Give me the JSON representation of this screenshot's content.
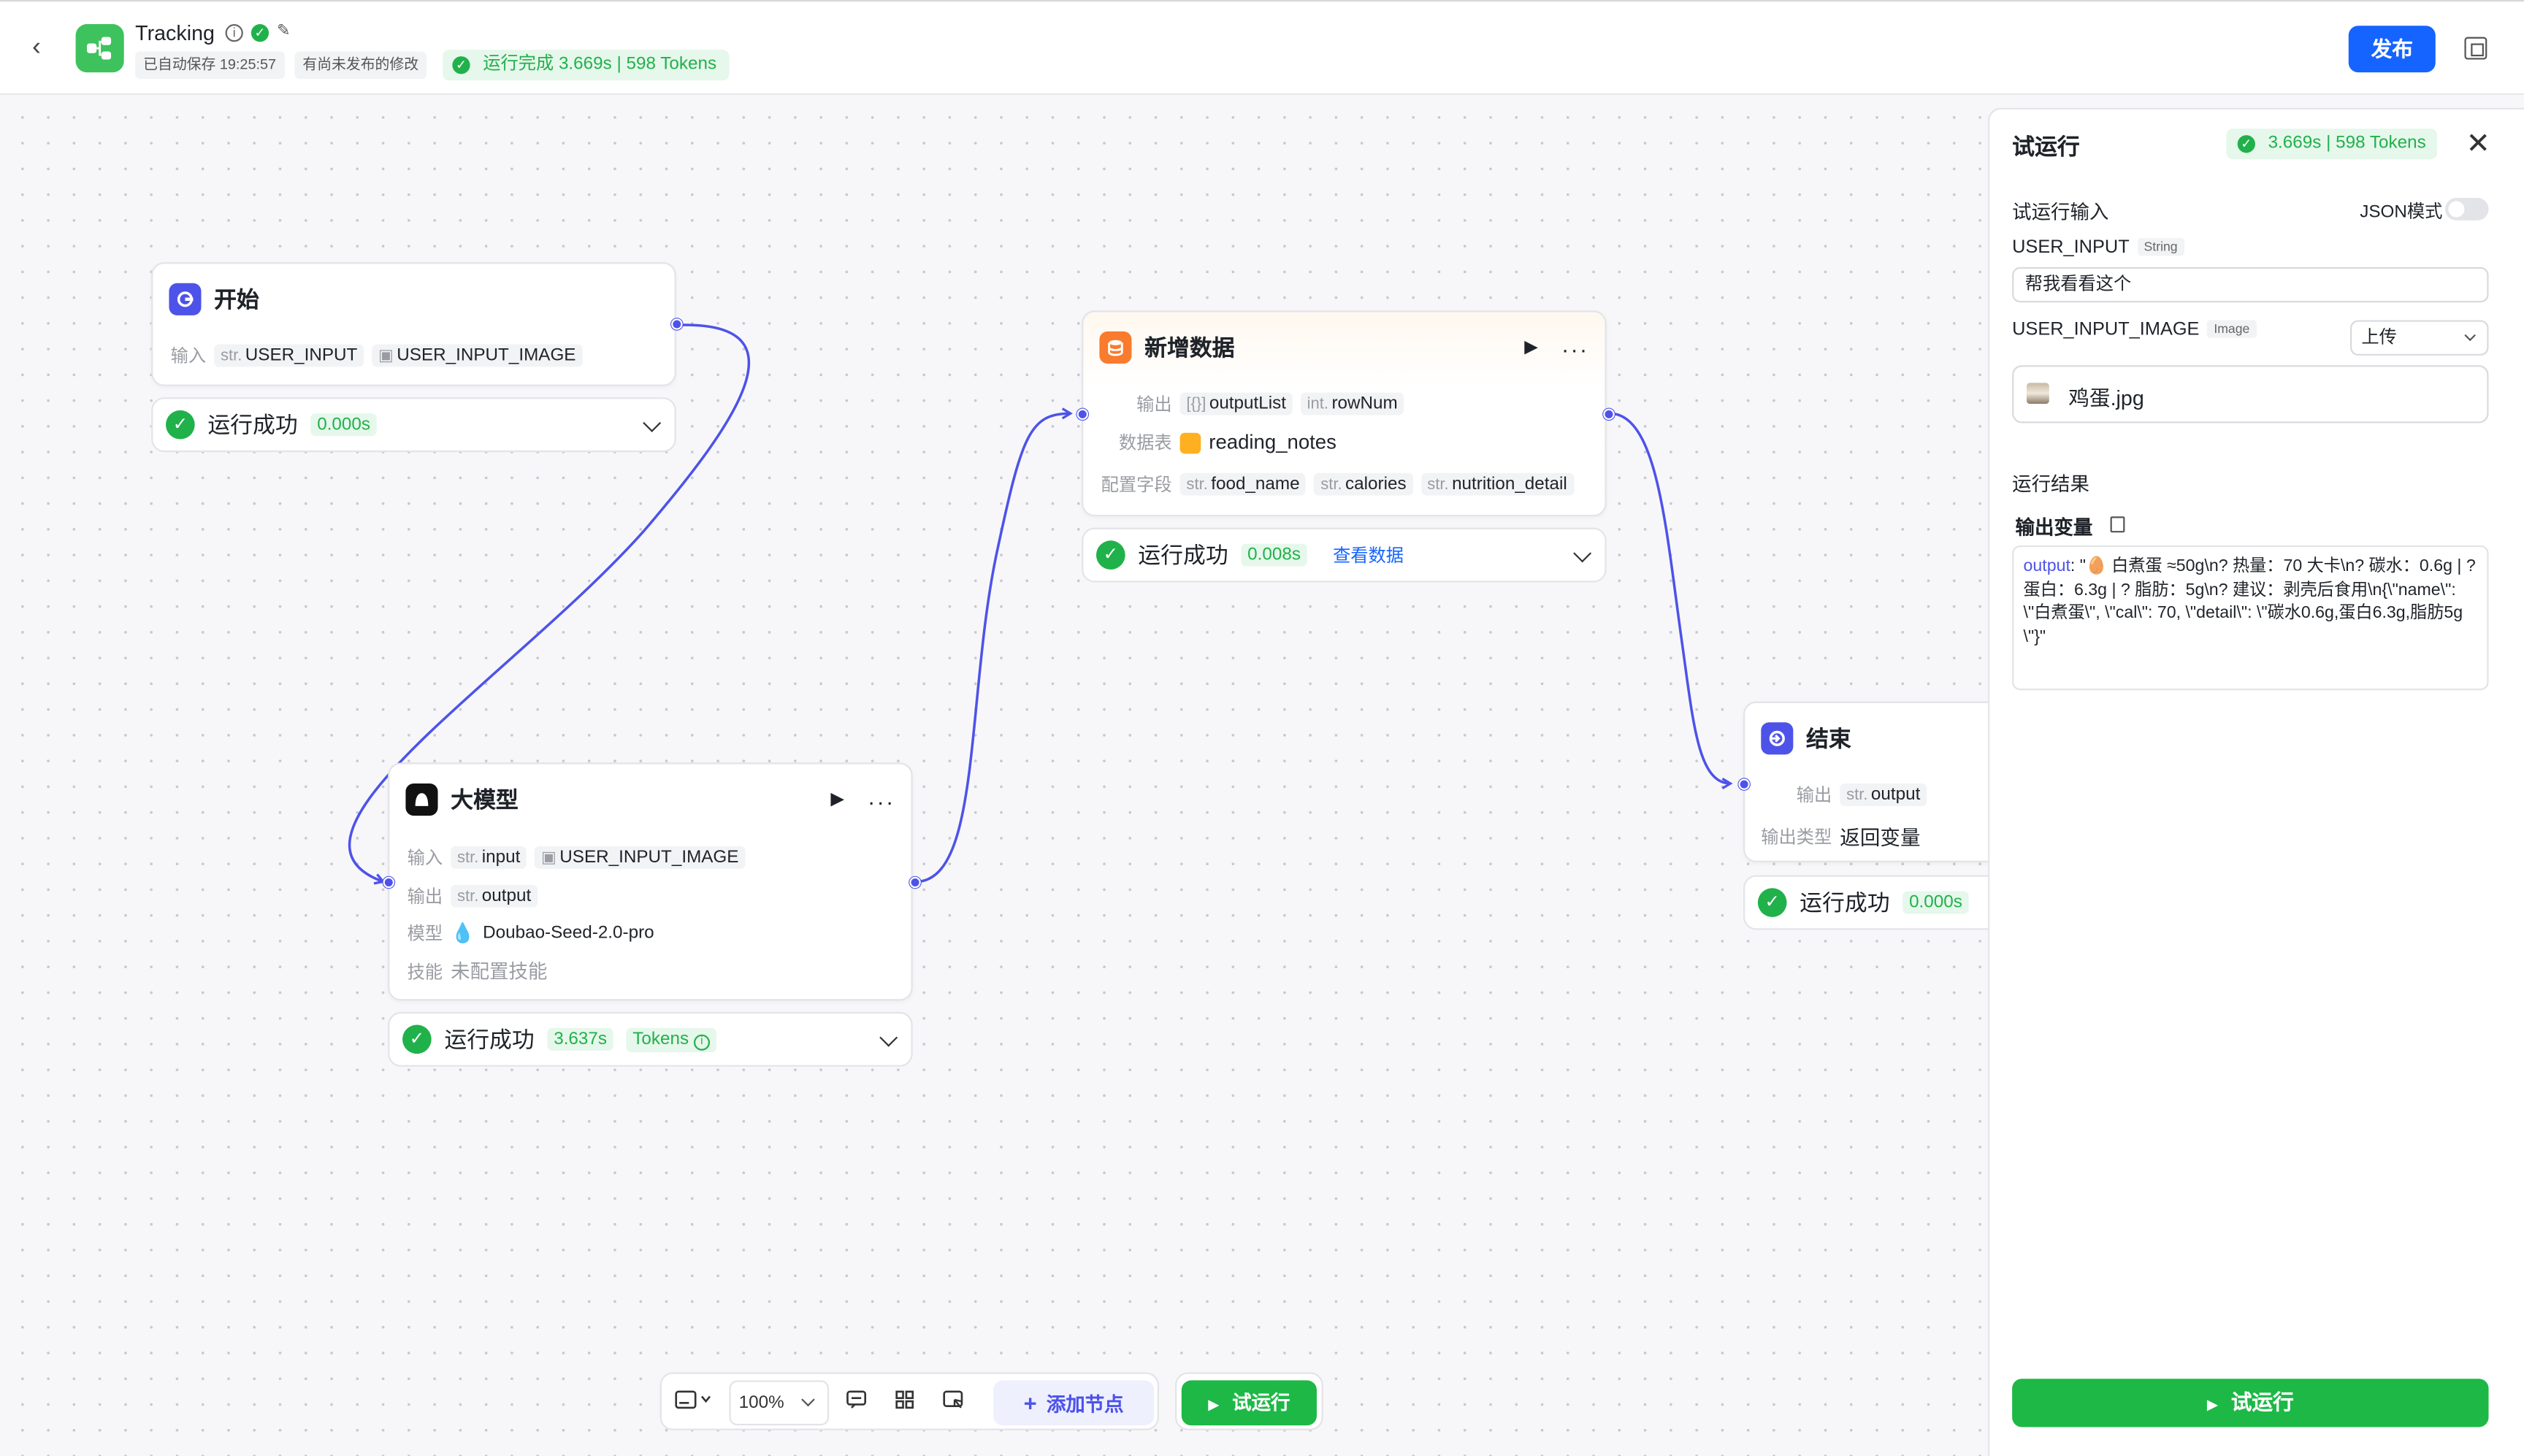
{
  "header": {
    "title": "Tracking",
    "autosave": "已自动保存 19:25:57",
    "unpublished": "有尚未发布的修改",
    "run_status": "运行完成 3.669s | 598 Tokens",
    "publish_label": "发布"
  },
  "nodes": {
    "start": {
      "title": "开始",
      "input_label": "输入",
      "inputs": [
        {
          "type": "str.",
          "name": "USER_INPUT"
        },
        {
          "type": "img",
          "name": "USER_INPUT_IMAGE"
        }
      ],
      "status": "运行成功",
      "time": "0.000s"
    },
    "llm": {
      "title": "大模型",
      "input_label": "输入",
      "output_label": "输出",
      "model_label": "模型",
      "skill_label": "技能",
      "inputs": [
        {
          "type": "str.",
          "name": "input"
        },
        {
          "type": "img",
          "name": "USER_INPUT_IMAGE"
        }
      ],
      "output": {
        "type": "str.",
        "name": "output"
      },
      "model": "Doubao-Seed-2.0-pro",
      "skill": "未配置技能",
      "status": "运行成功",
      "time": "3.637s",
      "tokens_label": "Tokens"
    },
    "add_data": {
      "title": "新增数据",
      "output_label": "输出",
      "table_label": "数据表",
      "fields_label": "配置字段",
      "outputs": [
        {
          "type": "[{}]",
          "name": "outputList"
        },
        {
          "type": "int.",
          "name": "rowNum"
        }
      ],
      "table": "reading_notes",
      "fields": [
        {
          "type": "str.",
          "name": "food_name"
        },
        {
          "type": "str.",
          "name": "calories"
        },
        {
          "type": "str.",
          "name": "nutrition_detail"
        }
      ],
      "status": "运行成功",
      "time": "0.008s",
      "view_link": "查看数据"
    },
    "end": {
      "title": "结束",
      "output_label": "输出",
      "output_type_label": "输出类型",
      "output": {
        "type": "str.",
        "name": "output"
      },
      "output_type": "返回变量",
      "status": "运行成功",
      "time": "0.000s"
    }
  },
  "toolbar": {
    "zoom": "100%",
    "add_node": "添加节点",
    "trial_run": "试运行"
  },
  "panel": {
    "title": "试运行",
    "stats": "3.669s | 598 Tokens",
    "input_section": "试运行输入",
    "json_mode": "JSON模式",
    "user_input_label": "USER_INPUT",
    "user_input_type": "String",
    "user_input_value": "帮我看看这个",
    "image_label": "USER_INPUT_IMAGE",
    "image_type": "Image",
    "upload_option": "上传",
    "file_name": "鸡蛋.jpg",
    "result_section": "运行结果",
    "output_var_label": "输出变量",
    "output_key": "output",
    "output_value": ": \"🥚 白煮蛋 ≈50g\\n? 热量：70 大卡\\n? 碳水：0.6g | ? 蛋白：6.3g | ? 脂肪：5g\\n? 建议：剥壳后食用\\n{\\\"name\\\": \\\"白煮蛋\\\", \\\"cal\\\": 70, \\\"detail\\\": \\\"碳水0.6g,蛋白6.3g,脂肪5g\\\"}\"",
    "run_button": "试运行"
  },
  "colors": {
    "accent": "#4d53e8",
    "primary": "#1664ff",
    "success": "#21b14b",
    "run_green": "#1db846"
  }
}
